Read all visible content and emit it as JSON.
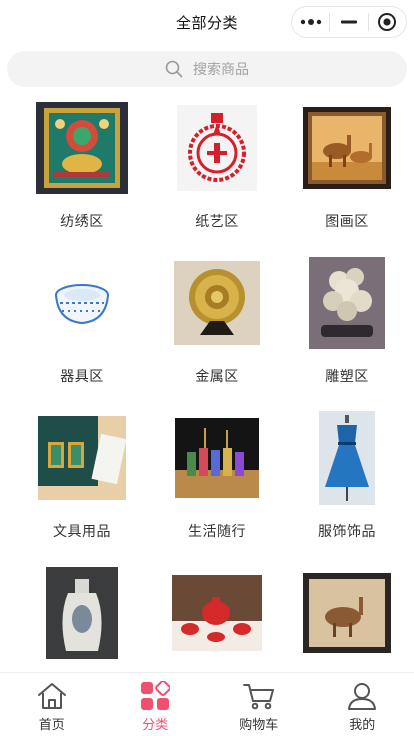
{
  "header": {
    "title": "全部分类"
  },
  "capsule": {
    "icons": [
      "more-dots-icon",
      "minimize-icon",
      "target-icon"
    ]
  },
  "search": {
    "placeholder": "搜索商品",
    "icon": "search-icon"
  },
  "categories": [
    {
      "label": "纺绣区",
      "thumb": "thangka-embroidery-thumb"
    },
    {
      "label": "纸艺区",
      "thumb": "papercut-thumb"
    },
    {
      "label": "图画区",
      "thumb": "camel-painting-thumb"
    },
    {
      "label": "器具区",
      "thumb": "porcelain-bowl-thumb"
    },
    {
      "label": "金属区",
      "thumb": "metal-plate-thumb"
    },
    {
      "label": "雕塑区",
      "thumb": "sculpture-thumb"
    },
    {
      "label": "文具用品",
      "thumb": "stationery-thumb"
    },
    {
      "label": "生活随行",
      "thumb": "daily-goods-thumb"
    },
    {
      "label": "服饰饰品",
      "thumb": "dress-thumb"
    },
    {
      "label": "",
      "thumb": "vase-thumb"
    },
    {
      "label": "",
      "thumb": "teaset-thumb"
    },
    {
      "label": "",
      "thumb": "camel-artwork-thumb"
    }
  ],
  "tabbar": {
    "items": [
      {
        "label": "首页",
        "icon": "home-icon",
        "active": false
      },
      {
        "label": "分类",
        "icon": "category-icon",
        "active": true
      },
      {
        "label": "购物车",
        "icon": "cart-icon",
        "active": false
      },
      {
        "label": "我的",
        "icon": "user-icon",
        "active": false
      }
    ]
  },
  "colors": {
    "accent": "#f0506e",
    "text": "#333333",
    "search_bg": "#f3f3f3"
  }
}
